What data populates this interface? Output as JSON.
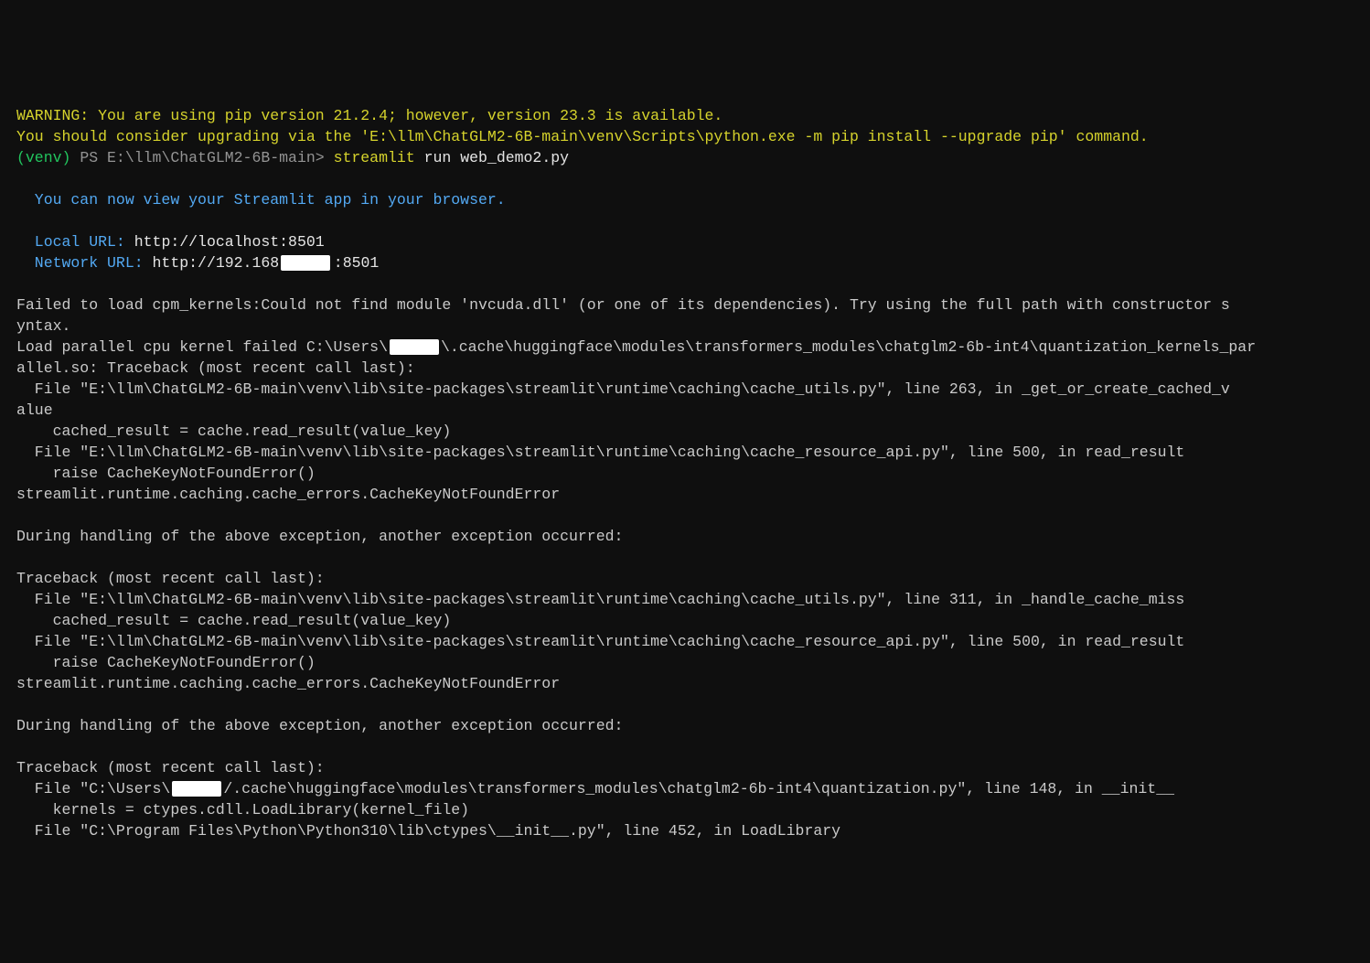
{
  "warn": {
    "l1": "WARNING: You are using pip version 21.2.4; however, version 23.3 is available.",
    "l2": "You should consider upgrading via the 'E:\\llm\\ChatGLM2-6B-main\\venv\\Scripts\\python.exe -m pip install --upgrade pip' command."
  },
  "prompt": {
    "venv": "(venv)",
    "ps": " PS E:\\llm\\ChatGLM2-6B-main> ",
    "cmd": "streamlit",
    "args": " run web_demo2.py"
  },
  "streamlit": {
    "msg": "  You can now view your Streamlit app in your browser.",
    "local_lbl": "  Local URL: ",
    "local_url": "http://localhost:8501",
    "net_lbl": "  Network URL: ",
    "net_url_pre": "http://192.168",
    "net_url_post": ":8501"
  },
  "err": {
    "e1": "Failed to load cpm_kernels:Could not find module 'nvcuda.dll' (or one of its dependencies). Try using the full path with constructor s",
    "e2": "yntax.",
    "e3a": "Load parallel cpu kernel failed C:\\Users\\",
    "e3b": "\\.cache\\huggingface\\modules\\transformers_modules\\chatglm2-6b-int4\\quantization_kernels_par",
    "e4": "allel.so: Traceback (most recent call last):",
    "e5": "  File \"E:\\llm\\ChatGLM2-6B-main\\venv\\lib\\site-packages\\streamlit\\runtime\\caching\\cache_utils.py\", line 263, in _get_or_create_cached_v",
    "e6": "alue",
    "e7": "    cached_result = cache.read_result(value_key)",
    "e8": "  File \"E:\\llm\\ChatGLM2-6B-main\\venv\\lib\\site-packages\\streamlit\\runtime\\caching\\cache_resource_api.py\", line 500, in read_result",
    "e9": "    raise CacheKeyNotFoundError()",
    "e10": "streamlit.runtime.caching.cache_errors.CacheKeyNotFoundError",
    "e11": "During handling of the above exception, another exception occurred:",
    "e12": "Traceback (most recent call last):",
    "e13": "  File \"E:\\llm\\ChatGLM2-6B-main\\venv\\lib\\site-packages\\streamlit\\runtime\\caching\\cache_utils.py\", line 311, in _handle_cache_miss",
    "e14": "    cached_result = cache.read_result(value_key)",
    "e15": "  File \"E:\\llm\\ChatGLM2-6B-main\\venv\\lib\\site-packages\\streamlit\\runtime\\caching\\cache_resource_api.py\", line 500, in read_result",
    "e16": "    raise CacheKeyNotFoundError()",
    "e17": "streamlit.runtime.caching.cache_errors.CacheKeyNotFoundError",
    "e18": "During handling of the above exception, another exception occurred:",
    "e19": "Traceback (most recent call last):",
    "e20a": "  File \"C:\\Users\\",
    "e20b": "/.cache\\huggingface\\modules\\transformers_modules\\chatglm2-6b-int4\\quantization.py\", line 148, in __init__",
    "e21": "    kernels = ctypes.cdll.LoadLibrary(kernel_file)",
    "e22": "  File \"C:\\Program Files\\Python\\Python310\\lib\\ctypes\\__init__.py\", line 452, in LoadLibrary"
  }
}
